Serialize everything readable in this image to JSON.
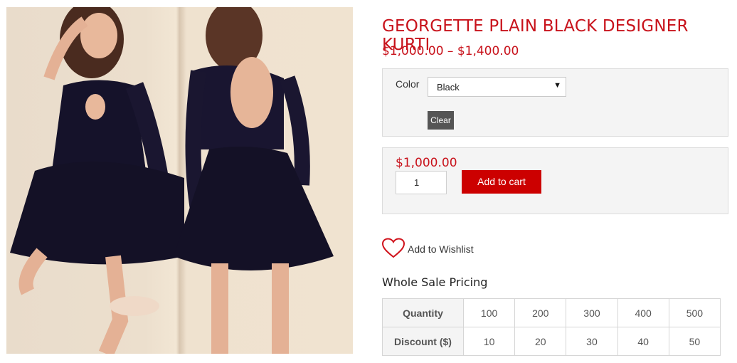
{
  "product": {
    "title": "GEORGETTE PLAIN BLACK DESIGNER KURTI",
    "price_range": "$1,000.00 – $1,400.00",
    "image_alt": "",
    "variation": {
      "label": "Color",
      "selected": "Black",
      "clear_label": "Clear"
    },
    "variant_price": "$1,000.00",
    "quantity": "1",
    "add_to_cart_label": "Add to cart",
    "wishlist_label": "Add to Wishlist"
  },
  "wholesale": {
    "heading": "Whole Sale Pricing",
    "quantity_label": "Quantity",
    "discount_label": "Discount ($)",
    "quantities": [
      "100",
      "200",
      "300",
      "400",
      "500"
    ],
    "discounts": [
      "10",
      "20",
      "30",
      "40",
      "50"
    ]
  },
  "colors": {
    "accent": "#c8121b",
    "button": "#cc0000",
    "clear_button": "#555555",
    "panel": "#f4f4f4"
  }
}
